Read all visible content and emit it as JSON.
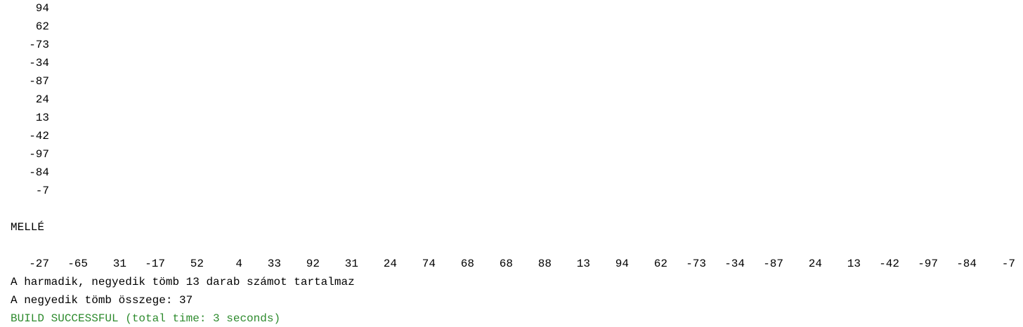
{
  "output": {
    "column_values": [
      "94",
      "62",
      "-73",
      "-34",
      "-87",
      "24",
      "13",
      "-42",
      "-97",
      "-84",
      "-7"
    ],
    "side_label": "MELLÉ",
    "row_values": [
      "-27",
      "-65",
      "31",
      "-17",
      "52",
      "4",
      "33",
      "92",
      "31",
      "24",
      "74",
      "68",
      "68",
      "88",
      "13",
      "94",
      "62",
      "-73",
      "-34",
      "-87",
      "24",
      "13",
      "-42",
      "-97",
      "-84",
      "-7"
    ],
    "count_message": "A harmadik, negyedik tömb 13 darab számot tartalmaz",
    "sum_message": "A negyedik tömb összege: 37",
    "build_status": "BUILD SUCCESSFUL (total time: 3 seconds)"
  },
  "colors": {
    "text": "#000000",
    "success": "#2e8b2e",
    "background": "#ffffff"
  }
}
